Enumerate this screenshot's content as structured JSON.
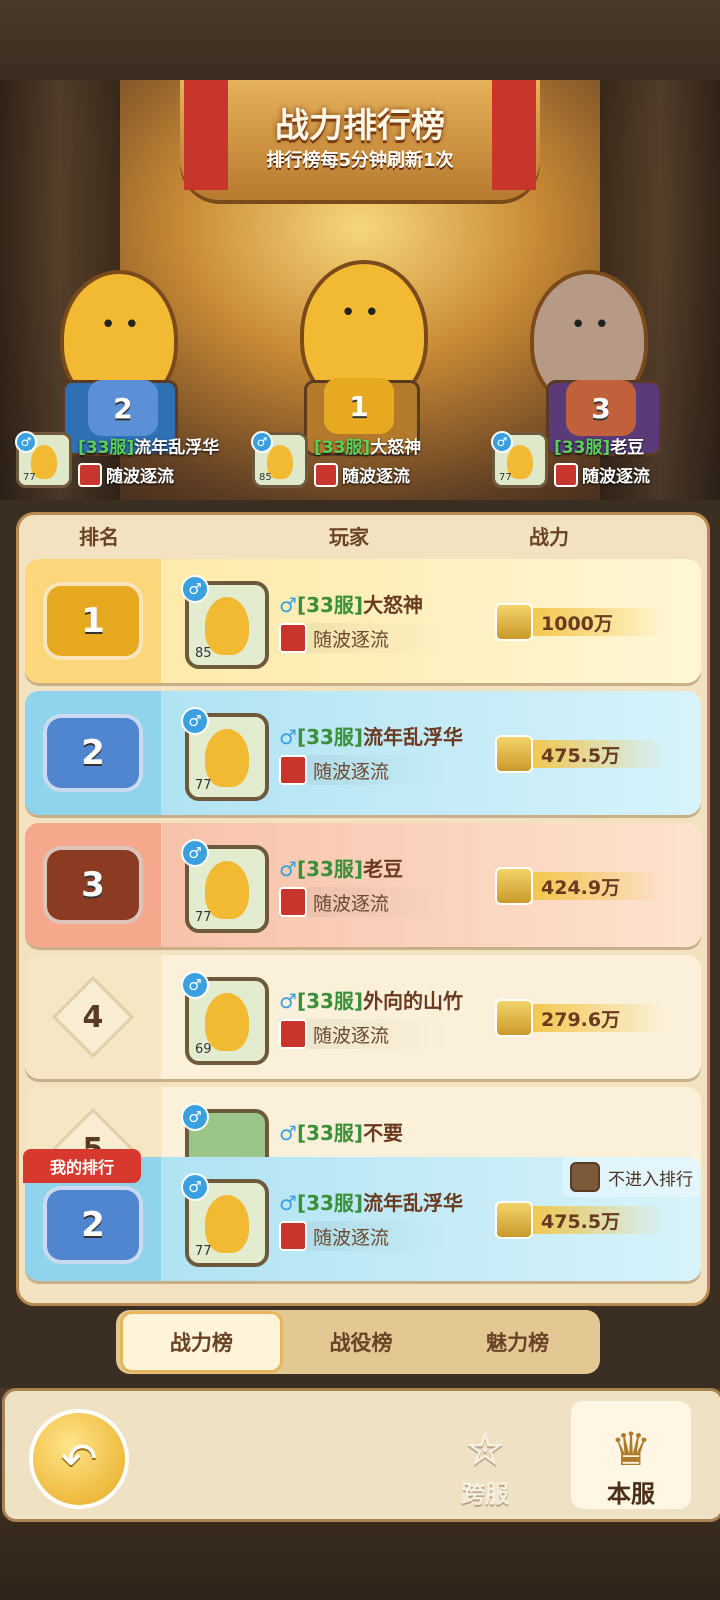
{
  "banner": {
    "title": "战力排行榜",
    "subtitle": "排行榜每5分钟刷新1次"
  },
  "podium": [
    {
      "rank": "2",
      "server": "[33服]",
      "name": "流年乱浮华",
      "guild": "随波逐流",
      "level": "77"
    },
    {
      "rank": "1",
      "server": "[33服]",
      "name": "大怒神",
      "guild": "随波逐流",
      "level": "85"
    },
    {
      "rank": "3",
      "server": "[33服]",
      "name": "老豆",
      "guild": "随波逐流",
      "level": "77"
    }
  ],
  "columns": {
    "rank": "排名",
    "player": "玩家",
    "power": "战力"
  },
  "rows": [
    {
      "rank": "1",
      "sex": "♂",
      "server": "[33服]",
      "name": "大怒神",
      "guild": "随波逐流",
      "level": "85",
      "power": "1000万"
    },
    {
      "rank": "2",
      "sex": "♂",
      "server": "[33服]",
      "name": "流年乱浮华",
      "guild": "随波逐流",
      "level": "77",
      "power": "475.5万"
    },
    {
      "rank": "3",
      "sex": "♂",
      "server": "[33服]",
      "name": "老豆",
      "guild": "随波逐流",
      "level": "77",
      "power": "424.9万"
    },
    {
      "rank": "4",
      "sex": "♂",
      "server": "[33服]",
      "name": "外向的山竹",
      "guild": "随波逐流",
      "level": "69",
      "power": "279.6万"
    },
    {
      "rank": "5",
      "sex": "♂",
      "server": "[33服]",
      "name": "不要",
      "guild": "",
      "level": "",
      "power": ""
    }
  ],
  "my_rank": {
    "label": "我的排行",
    "rank": "2",
    "sex": "♂",
    "server": "[33服]",
    "name": "流年乱浮华",
    "guild": "随波逐流",
    "level": "77",
    "power": "475.5万",
    "opt_out_label": "不进入排行"
  },
  "tabs": [
    {
      "label": "战力榜",
      "active": true
    },
    {
      "label": "战役榜",
      "active": false
    },
    {
      "label": "魅力榜",
      "active": false
    }
  ],
  "bottom": {
    "back_icon": "back-arrow-icon",
    "cross_server": "跨服",
    "local_server": "本服"
  },
  "colors": {
    "gold": "#f3c64a",
    "blue": "#a6dff0",
    "bronze": "#f7b9a0",
    "cream": "#f8edd3",
    "server_green": "#3b8f3b",
    "male_blue": "#3aa0e0"
  }
}
